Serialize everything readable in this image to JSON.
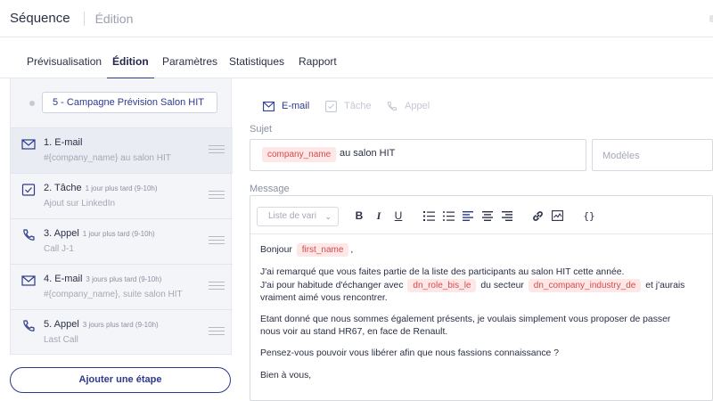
{
  "header": {
    "title": "Séquence",
    "crumb": "Édition"
  },
  "tabs": [
    {
      "label": "Prévisualisation"
    },
    {
      "label": "Édition"
    },
    {
      "label": "Paramètres"
    },
    {
      "label": "Statistiques"
    },
    {
      "label": "Rapport"
    }
  ],
  "sequence_name": "5 - Campagne Prévision Salon HIT",
  "steps": [
    {
      "icon": "mail-icon",
      "name": "1. E-mail",
      "delay": "",
      "sub": "#{company_name} au salon HIT"
    },
    {
      "icon": "task-icon",
      "name": "2. Tâche",
      "delay": "1 jour plus tard (9-10h)",
      "sub": "Ajout sur LinkedIn"
    },
    {
      "icon": "phone-icon",
      "name": "3. Appel",
      "delay": "1 jour plus tard (9-10h)",
      "sub": "Call J-1"
    },
    {
      "icon": "mail-icon",
      "name": "4. E-mail",
      "delay": "3 jours plus tard (9-10h)",
      "sub": "#{company_name}, suite salon HIT"
    },
    {
      "icon": "phone-icon",
      "name": "5. Appel",
      "delay": "3 jours plus tard (9-10h)",
      "sub": "Last Call"
    }
  ],
  "add_step_label": "Ajouter une étape",
  "channels": {
    "email": "E-mail",
    "task": "Tâche",
    "call": "Appel"
  },
  "subject": {
    "label": "Sujet",
    "tag": "company_name",
    "text": "au salon HIT",
    "templates_placeholder": "Modèles"
  },
  "message": {
    "label": "Message",
    "variables_placeholder": "Liste de vari",
    "greeting": "Bonjour",
    "greeting_tag": "first_name",
    "greeting_end": ",",
    "line1": "J'ai remarqué que vous faites partie de la liste des participants au salon HIT cette année.",
    "line2a": "J'ai pour habitude d'échanger avec",
    "tag_role": "dn_role_bis_le",
    "line2b": "du secteur",
    "tag_industry": "dn_company_industry_de",
    "line2c": "et j'aurais",
    "line2d": "vraiment aimé vous rencontrer.",
    "para2": "Etant donné que nous sommes également présents, je voulais simplement vous proposer de passer nous voir au stand HR67, en face de Renault.",
    "para3": "Pensez-vous pouvoir vous libérer afin que nous fassions connaissance ?",
    "para4": "Bien à vous,"
  },
  "colors": {
    "accent": "#2d3a8c",
    "tag_bg": "#fde7e7",
    "tag_text": "#d94a4a"
  }
}
